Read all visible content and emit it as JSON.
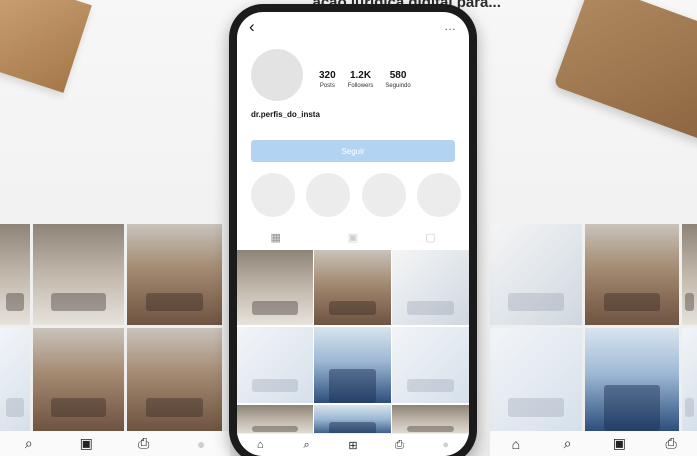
{
  "headline": "...ação jurídica digital para...",
  "profile": {
    "username": "dr.perfis_do_insta",
    "posts_count": "320",
    "posts_label": "Posts",
    "followers_count": "1.2K",
    "followers_label": "Followers",
    "following_count": "580",
    "following_label": "Seguindo",
    "follow_label": "Seguir"
  },
  "icons": {
    "back": "‹",
    "more": "…",
    "grid": "▦",
    "reels": "▣",
    "tagged": "▢",
    "home": "⌂",
    "search": "⌕",
    "add": "⊞",
    "shop": "⎙",
    "profile": "●"
  },
  "colors": {
    "follow_button": "#b3d3f3"
  }
}
